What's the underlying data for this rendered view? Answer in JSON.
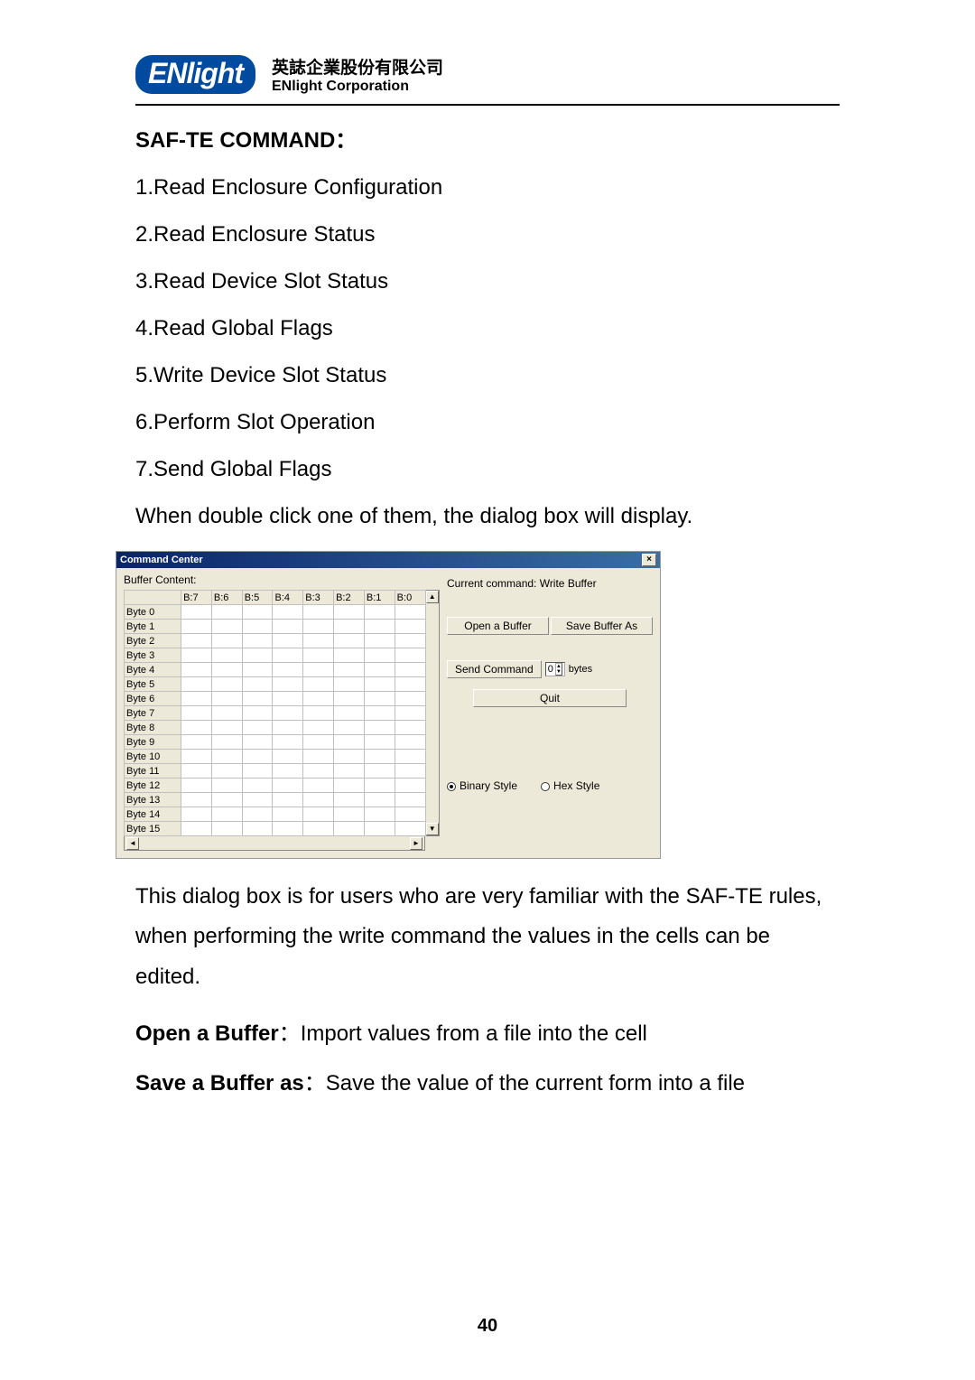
{
  "header": {
    "logo_text": "ENlight",
    "cjk": "英誌企業股份有限公司",
    "en": "ENlight Corporation"
  },
  "section": {
    "title": "SAF-TE COMMAND：",
    "commands": [
      "1.Read Enclosure Configuration",
      "2.Read Enclosure Status",
      "3.Read Device Slot Status",
      "4.Read Global Flags",
      "5.Write Device Slot Status",
      "6.Perform Slot Operation",
      "7.Send Global Flags"
    ],
    "sentence_after_list": "When double click one of them, the dialog box will display."
  },
  "dialog": {
    "title": "Command Center",
    "close_glyph": "×",
    "buffer_label": "Buffer Content:",
    "columns": [
      "B:7",
      "B:6",
      "B:5",
      "B:4",
      "B:3",
      "B:2",
      "B:1",
      "B:0"
    ],
    "rows": [
      "Byte 0",
      "Byte 1",
      "Byte 2",
      "Byte 3",
      "Byte 4",
      "Byte 5",
      "Byte 6",
      "Byte 7",
      "Byte 8",
      "Byte 9",
      "Byte 10",
      "Byte 11",
      "Byte 12",
      "Byte 13",
      "Byte 14",
      "Byte 15"
    ],
    "scroll": {
      "up": "▲",
      "down": "▼",
      "left": "◄",
      "right": "►"
    },
    "current_command_label": "Current command: Write Buffer",
    "open_buffer_btn": "Open a Buffer",
    "save_buffer_btn": "Save Buffer As",
    "send_command_btn": "Send Command",
    "send_value": "0",
    "bytes_label": "bytes",
    "quit_btn": "Quit",
    "binary_style_label": "Binary Style",
    "hex_style_label": "Hex Style",
    "selected_style": "binary"
  },
  "paragraph_after_dialog": "This dialog box is for users who are very familiar with the SAF-TE rules, when performing the write command the values in the cells can be edited.",
  "definitions": [
    {
      "label": "Open a Buffer",
      "sep": "：",
      "desc": "Import values from a file into the cell"
    },
    {
      "label": "Save a Buffer as",
      "sep": "：",
      "desc": "Save the value of the current form into a file"
    }
  ],
  "page_number": "40"
}
